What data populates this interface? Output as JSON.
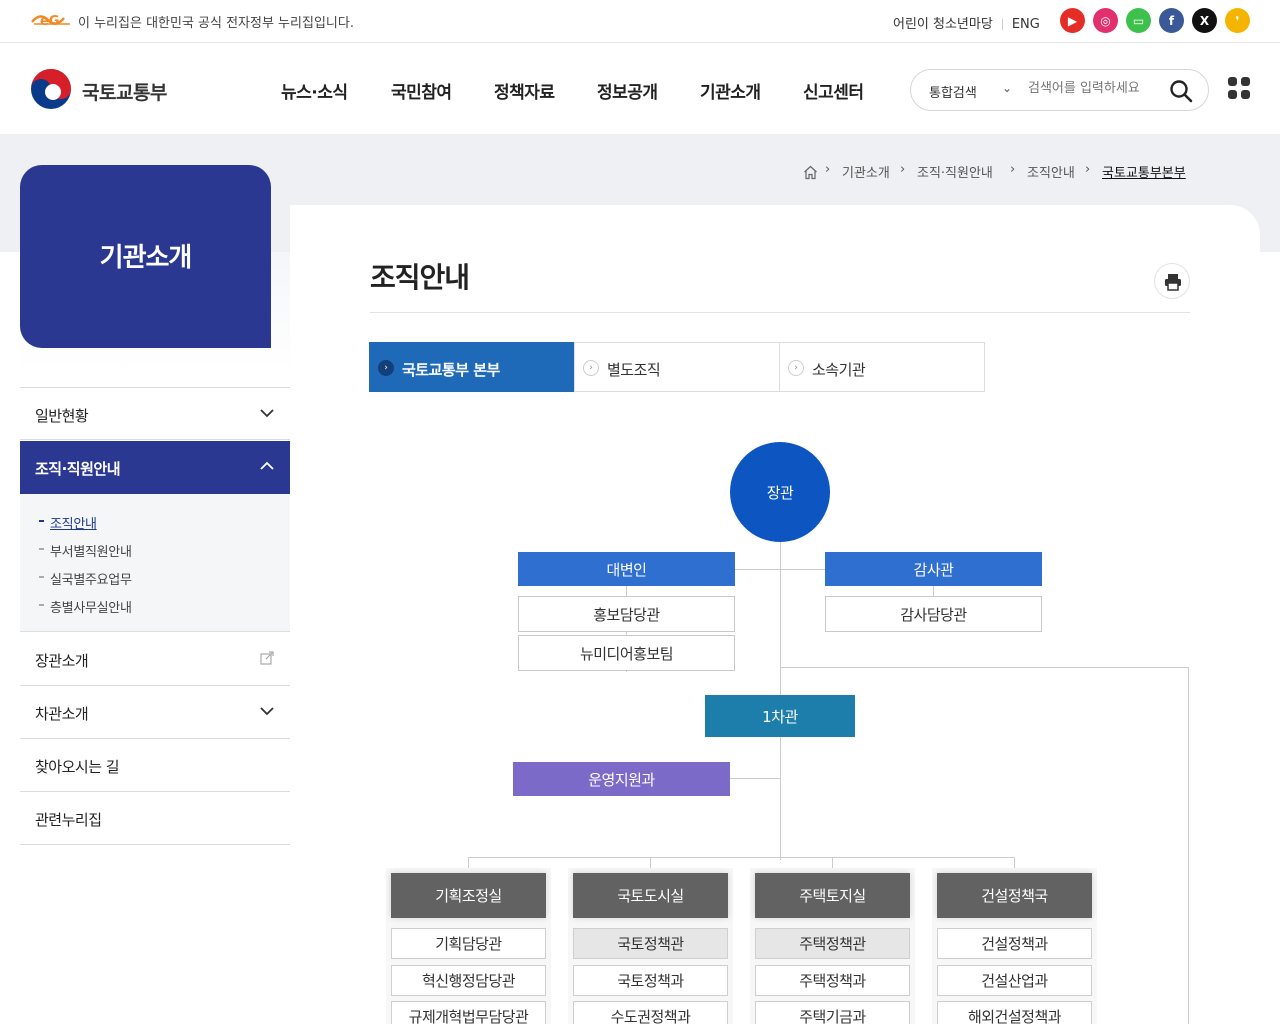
{
  "gov_bar": {
    "notice": "이 누리집은 대한민국 공식 전자정부 누리집입니다.",
    "links": [
      "어린이 청소년마당",
      "ENG"
    ],
    "sns": [
      {
        "name": "youtube-icon",
        "color": "#e52d27"
      },
      {
        "name": "instagram-icon",
        "color": "#e1306c"
      },
      {
        "name": "blog-icon",
        "color": "#3ec04d"
      },
      {
        "name": "facebook-icon",
        "color": "#3b5998"
      },
      {
        "name": "x-icon",
        "color": "#111111"
      },
      {
        "name": "kakaostory-icon",
        "color": "#f5b400"
      }
    ]
  },
  "header": {
    "site_name": "국토교통부",
    "gnb": [
      "뉴스·소식",
      "국민참여",
      "정책자료",
      "정보공개",
      "기관소개",
      "신고센터"
    ],
    "search": {
      "scope": "통합검색",
      "placeholder": "검색어를 입력하세요"
    }
  },
  "breadcrumb": [
    "기관소개",
    "조직·직원안내",
    "조직안내",
    "국토교통부본부"
  ],
  "sidebar": {
    "title": "기관소개",
    "items": [
      {
        "label": "일반현황"
      },
      {
        "label": "조직·직원안내",
        "active": true
      },
      {
        "label": "장관소개"
      },
      {
        "label": "차관소개"
      },
      {
        "label": "찾아오시는 길"
      },
      {
        "label": "관련누리집"
      }
    ],
    "sub_items": [
      "조직안내",
      "부서별직원안내",
      "실국별주요업무",
      "층별사무실안내"
    ]
  },
  "main": {
    "title": "조직안내",
    "tabs": [
      "국토교통부 본부",
      "별도조직",
      "소속기관"
    ]
  },
  "org": {
    "minister": "장관",
    "spokesperson": "대변인",
    "spokes_units": [
      "홍보담당관",
      "뉴미디어홍보팀"
    ],
    "auditor": "감사관",
    "auditor_units": [
      "감사담당관"
    ],
    "vice_minister": "1차관",
    "support": "운영지원과",
    "departments": [
      {
        "name": "기획조정실",
        "units": [
          "기획담당관",
          "혁신행정담당관",
          "규제개혁법무담당관"
        ]
      },
      {
        "name": "국토도시실",
        "units": [
          "국토정책관",
          "국토정책과",
          "수도권정책과"
        ]
      },
      {
        "name": "주택토지실",
        "units": [
          "주택정책관",
          "주택정책과",
          "주택기금과"
        ]
      },
      {
        "name": "건설정책국",
        "units": [
          "건설정책과",
          "건설산업과",
          "해외건설정책과"
        ]
      }
    ]
  }
}
